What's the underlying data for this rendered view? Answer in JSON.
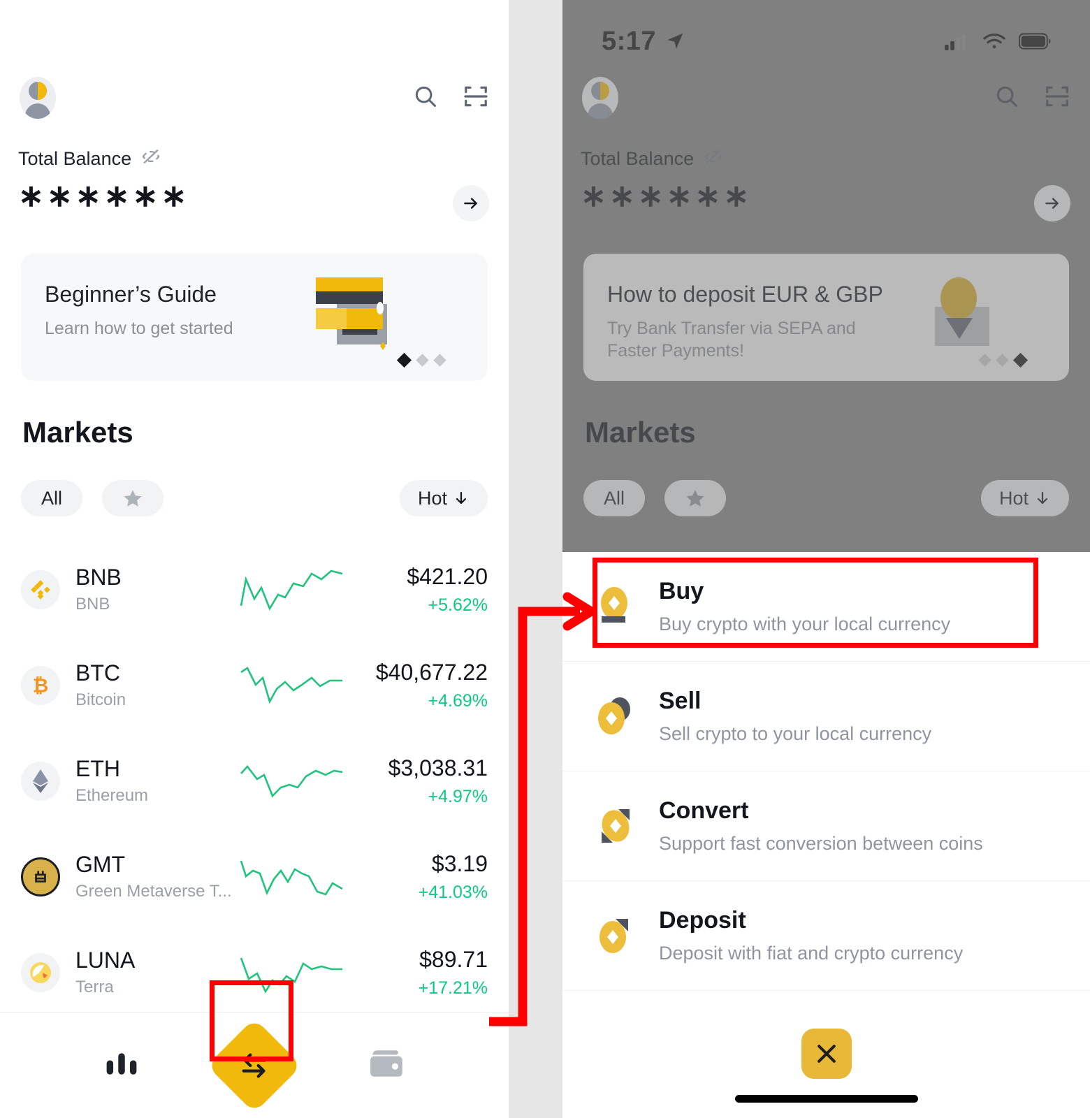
{
  "status_bar": {
    "time": "5:17",
    "location_icon": "location-arrow-icon",
    "signal_icon": "cellular-signal-icon",
    "wifi_icon": "wifi-icon",
    "battery_icon": "battery-full-icon"
  },
  "header": {
    "avatar": "user-avatar",
    "search_icon": "search-icon",
    "scan_icon": "scan-qr-icon"
  },
  "balance": {
    "label": "Total Balance",
    "hide_icon": "eye-off-icon",
    "value": "∗∗∗∗∗∗",
    "arrow_icon": "arrow-right-icon"
  },
  "promo_left": {
    "title": "Beginner’s Guide",
    "subtitle": "Learn how to get started",
    "art": "credit-cards-illustration",
    "dots": [
      "active",
      "inactive",
      "inactive"
    ]
  },
  "promo_right": {
    "title": "How to deposit EUR & GBP",
    "subtitle": "Try Bank Transfer via SEPA and Faster Payments!",
    "art": "coin-deposit-illustration",
    "dots": [
      "inactive",
      "inactive",
      "active"
    ]
  },
  "markets": {
    "heading": "Markets",
    "filters": {
      "all_label": "All",
      "favorites_icon": "star-icon",
      "sort_label": "Hot",
      "sort_icon": "arrow-down-icon"
    },
    "rows": [
      {
        "symbol": "BNB",
        "name": "BNB",
        "price": "$421.20",
        "change": "+5.62%",
        "icon": "bnb-coin-icon",
        "trend": "up"
      },
      {
        "symbol": "BTC",
        "name": "Bitcoin",
        "price": "$40,677.22",
        "change": "+4.69%",
        "icon": "btc-coin-icon",
        "trend": "up"
      },
      {
        "symbol": "ETH",
        "name": "Ethereum",
        "price": "$3,038.31",
        "change": "+4.97%",
        "icon": "eth-coin-icon",
        "trend": "up"
      },
      {
        "symbol": "GMT",
        "name": "Green Metaverse T...",
        "price": "$3.19",
        "change": "+41.03%",
        "icon": "gmt-coin-icon",
        "trend": "down"
      },
      {
        "symbol": "LUNA",
        "name": "Terra",
        "price": "$89.71",
        "change": "+17.21%",
        "icon": "luna-coin-icon",
        "trend": "up"
      }
    ]
  },
  "bottom_nav": {
    "markets_icon": "bar-chart-icon",
    "trade_icon": "swap-arrows-icon",
    "wallet_icon": "wallet-icon"
  },
  "action_sheet": {
    "items": [
      {
        "title": "Buy",
        "desc": "Buy crypto with your local currency",
        "icon": "buy-coin-icon"
      },
      {
        "title": "Sell",
        "desc": "Sell crypto to your local currency",
        "icon": "sell-coin-icon"
      },
      {
        "title": "Convert",
        "desc": "Support fast conversion between coins",
        "icon": "convert-coin-icon"
      },
      {
        "title": "Deposit",
        "desc": "Deposit with fiat and crypto currency",
        "icon": "deposit-coin-icon"
      }
    ],
    "close_icon": "close-x-icon"
  },
  "annotations": {
    "highlight_color": "#ff0000",
    "trade_button_box": "trade-button-highlight",
    "buy_item_box": "buy-item-highlight",
    "connector": "trade-to-buy-arrow"
  },
  "colors": {
    "brand_yellow": "#f0b90b",
    "positive_green": "#0ecb81",
    "text_dark": "#12161c",
    "text_muted": "#9aa0a6",
    "surface": "#f7f8fa"
  }
}
